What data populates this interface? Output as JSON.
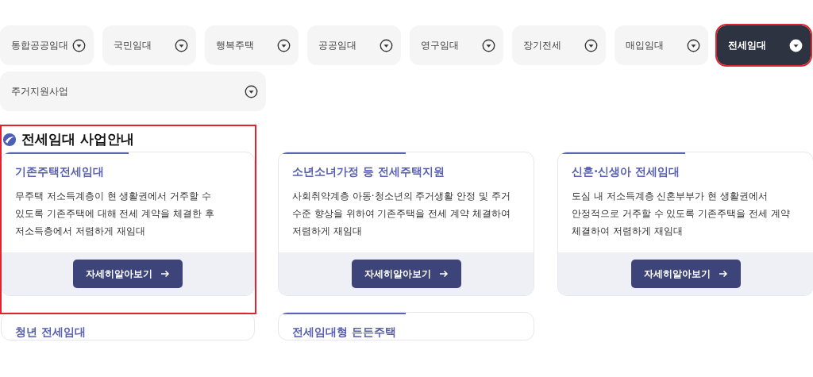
{
  "tabs": [
    {
      "label": "통합공공임대",
      "selected": false,
      "highlighted": false
    },
    {
      "label": "국민임대",
      "selected": false,
      "highlighted": false
    },
    {
      "label": "행복주택",
      "selected": false,
      "highlighted": false
    },
    {
      "label": "공공임대",
      "selected": false,
      "highlighted": false
    },
    {
      "label": "영구임대",
      "selected": false,
      "highlighted": false
    },
    {
      "label": "장기전세",
      "selected": false,
      "highlighted": false
    },
    {
      "label": "매입임대",
      "selected": false,
      "highlighted": false
    },
    {
      "label": "전세임대",
      "selected": true,
      "highlighted": true
    },
    {
      "label": "주거지원사업",
      "selected": false,
      "highlighted": false
    }
  ],
  "section": {
    "title": "전세임대 사업안내",
    "highlighted": true
  },
  "cards": [
    {
      "title": "기존주택전세임대",
      "description": "무주택 저소득계층이 현 생활권에서 거주할 수 있도록 기존주택에 대해 전세 계약을 체결한 후 저소득층에서 저렴하게 재임대",
      "button": "자세히알아보기"
    },
    {
      "title": "소년소녀가정 등 전세주택지원",
      "description": "사회취약계층 아동·청소년의 주거생활 안정 및 주거 수준 향상을 위하여 기존주택을 전세 계약 체결하여 저렴하게 재임대",
      "button": "자세히알아보기"
    },
    {
      "title": "신혼·신생아 전세임대",
      "description": "도심 내 저소득계층 신혼부부가 현 생활권에서 안정적으로 거주할 수 있도록 기존주택을 전세 계약 체결하여 저렴하게 재임대",
      "button": "자세히알아보기"
    },
    {
      "title": "청년 전세임대"
    },
    {
      "title": "전세임대형 든든주택"
    }
  ]
}
